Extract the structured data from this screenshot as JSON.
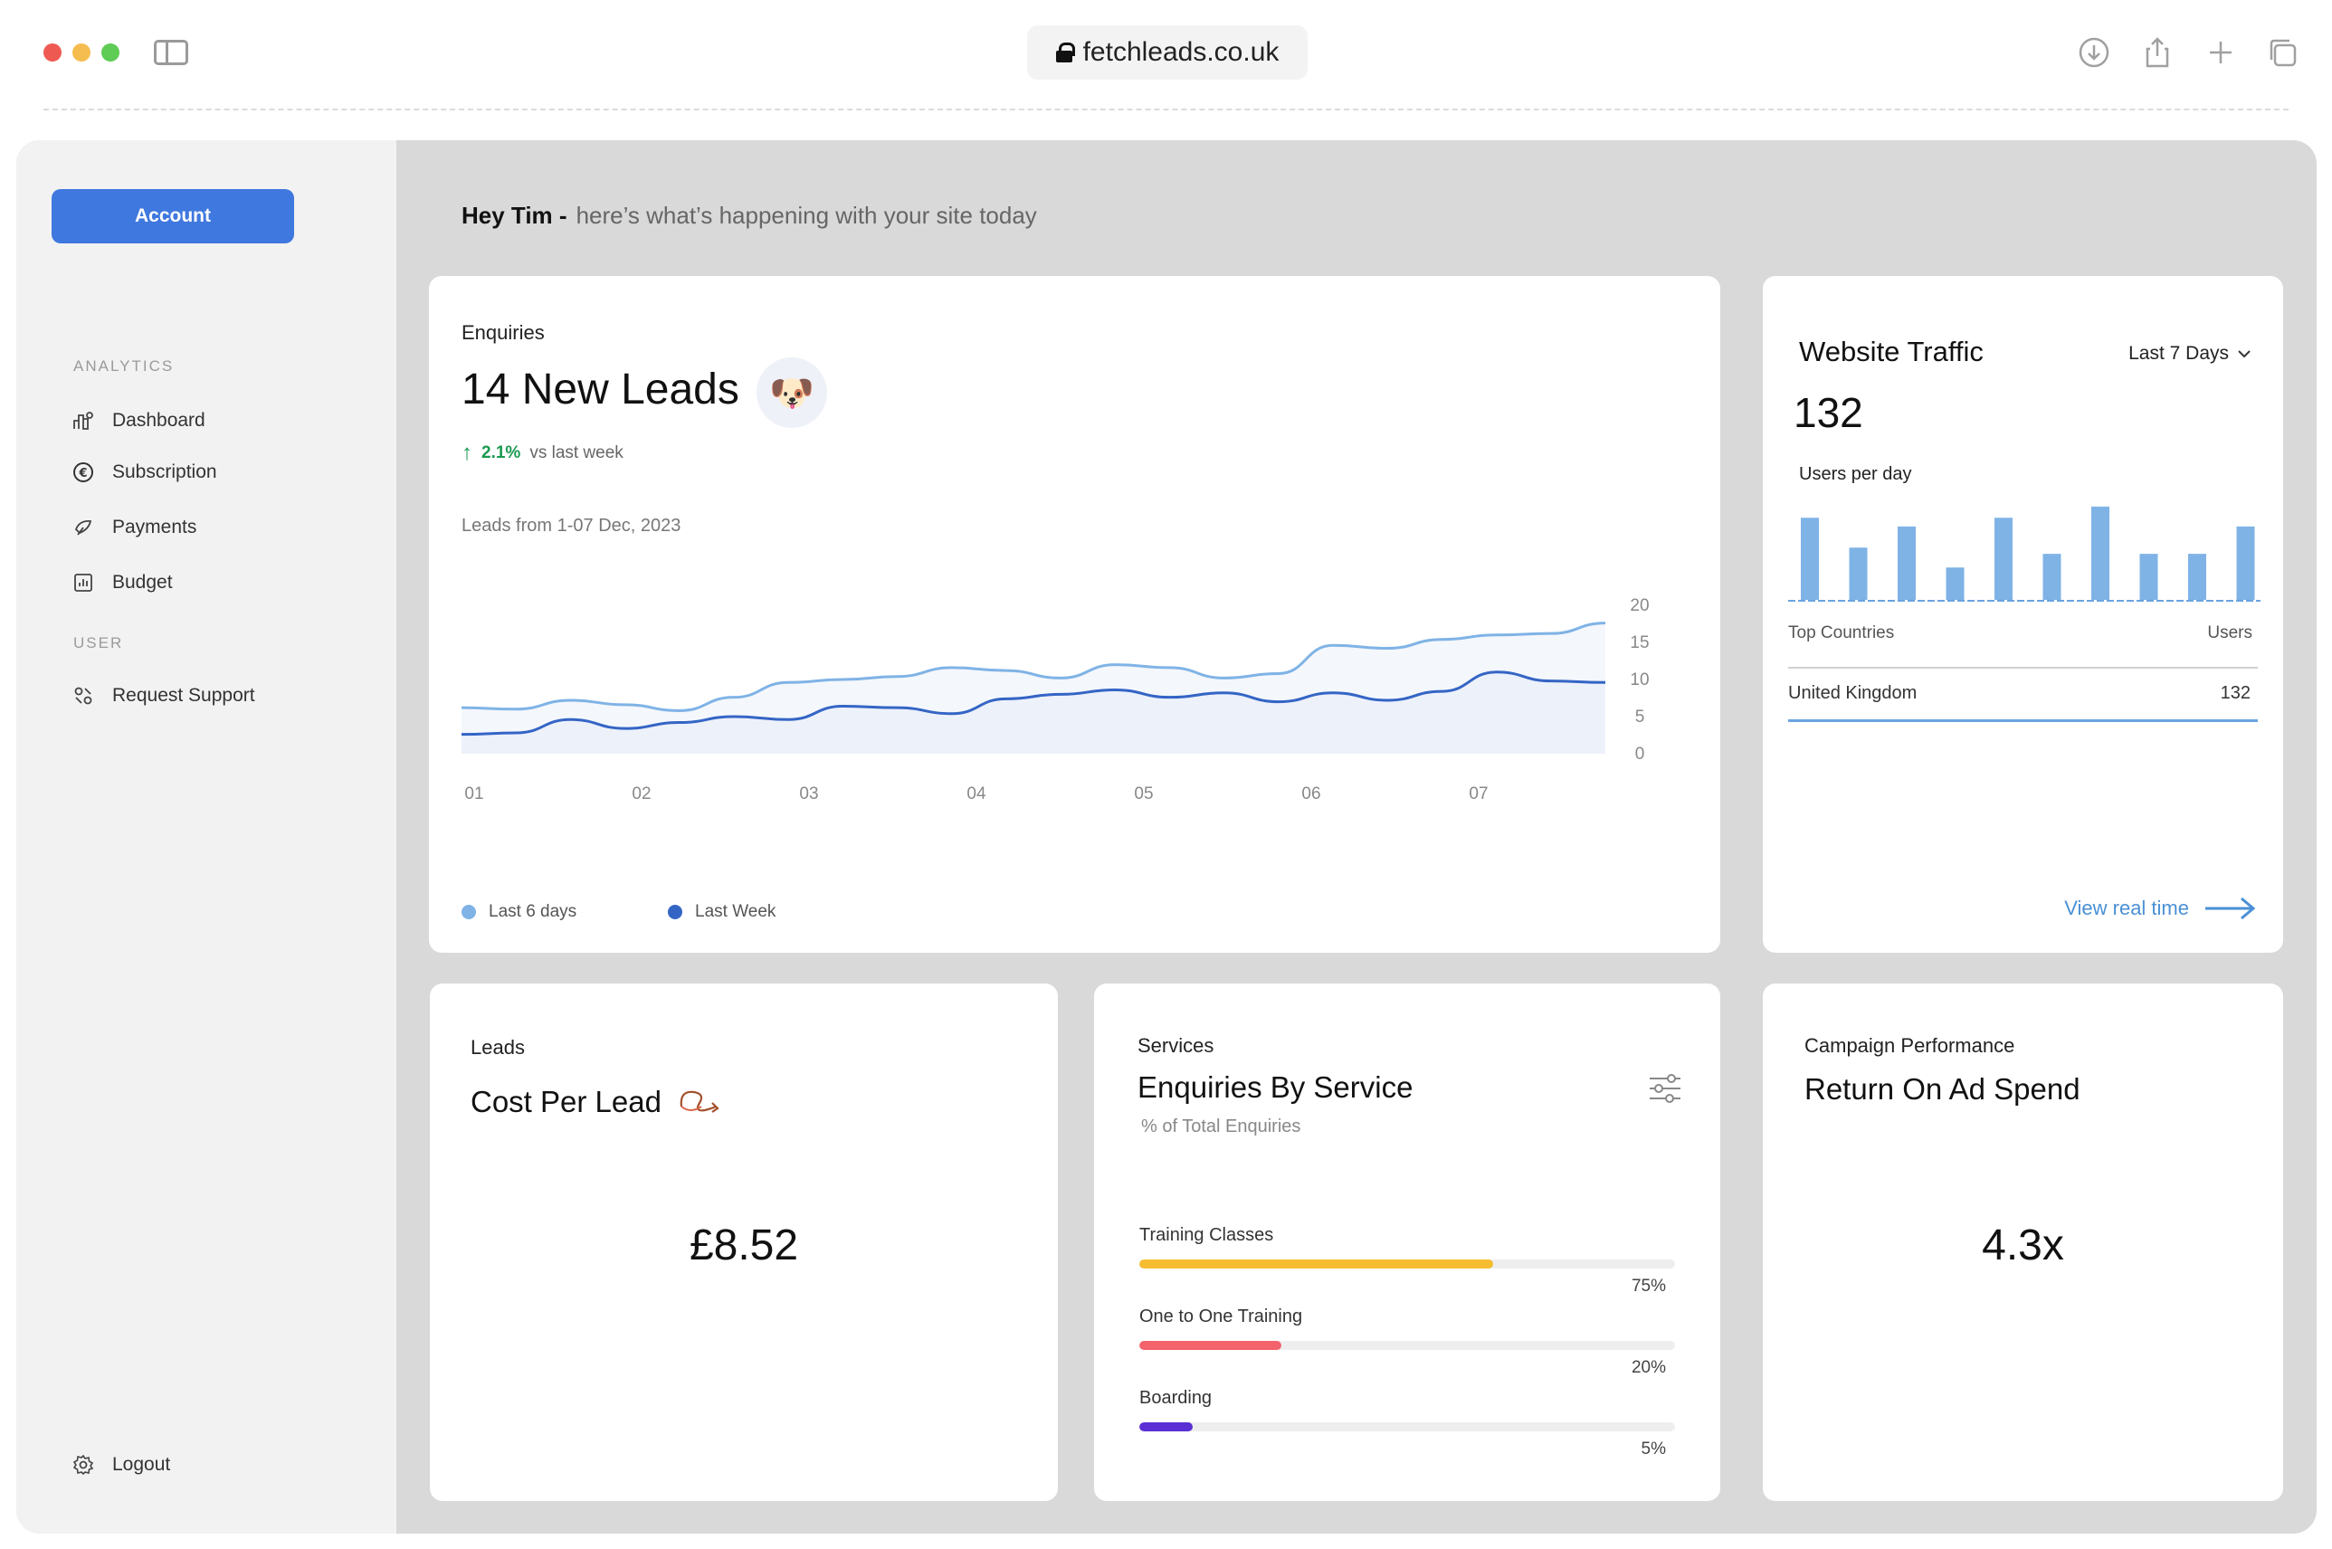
{
  "browser": {
    "url": "fetchleads.co.uk"
  },
  "sidebar": {
    "account_button": "Account",
    "section_analytics": "ANALYTICS",
    "section_user": "USER",
    "items": [
      {
        "label": "Dashboard",
        "icon": "bar-chart-icon"
      },
      {
        "label": "Subscription",
        "icon": "euro-icon"
      },
      {
        "label": "Payments",
        "icon": "payments-icon"
      },
      {
        "label": "Budget",
        "icon": "budget-icon"
      },
      {
        "label": "Request Support",
        "icon": "support-icon"
      }
    ],
    "logout": "Logout"
  },
  "greeting": {
    "name": "Hey Tim -",
    "message": "here’s what’s happening with your site today"
  },
  "enquiries": {
    "label": "Enquiries",
    "headline": "14 New Leads",
    "delta_pct": "2.1%",
    "delta_text": "vs last week",
    "chart_subtitle": "Leads from 1-07 Dec, 2023",
    "legend": [
      "Last 6 days",
      "Last Week"
    ],
    "colors": {
      "series_a": "#7fb3e6",
      "series_b": "#3465c5",
      "area": "#edf1fa"
    }
  },
  "chart_data": {
    "type": "area",
    "x_ticks": [
      "01",
      "02",
      "03",
      "04",
      "05",
      "06",
      "07"
    ],
    "y_ticks": [
      "20",
      "15",
      "10",
      "5",
      "0"
    ],
    "ylim": [
      0,
      20
    ],
    "series": [
      {
        "name": "Last 6 days",
        "values": [
          6.2,
          6.0,
          7.2,
          6.6,
          5.8,
          7.6,
          9.6,
          10.0,
          10.4,
          11.6,
          11.2,
          10.2,
          12.0,
          11.6,
          10.2,
          10.8,
          14.6,
          14.2,
          15.4,
          16.0,
          16.2,
          17.6
        ]
      },
      {
        "name": "Last Week",
        "values": [
          2.6,
          2.8,
          4.6,
          3.4,
          4.2,
          5.0,
          4.6,
          6.4,
          6.2,
          5.4,
          7.4,
          8.0,
          8.6,
          7.6,
          8.2,
          7.0,
          8.2,
          7.2,
          8.4,
          11.0,
          9.8,
          9.6
        ]
      }
    ]
  },
  "traffic": {
    "title": "Website Traffic",
    "range": "Last 7 Days",
    "value": "132",
    "subtitle": "Users per day",
    "bars": [
      66,
      42,
      59,
      26,
      66,
      37,
      75,
      37,
      37,
      59
    ],
    "col_country": "Top Countries",
    "col_users": "Users",
    "rows": [
      {
        "country": "United Kingdom",
        "users": "132"
      }
    ],
    "link": "View real time",
    "bar_color": "#7fb3e6"
  },
  "cpl": {
    "label": "Leads",
    "title": "Cost Per Lead",
    "value": "£8.52"
  },
  "services": {
    "label": "Services",
    "title": "Enquiries By Service",
    "subtitle": "% of Total Enquiries",
    "rows": [
      {
        "label": "Training Classes",
        "pct": "75%",
        "value": 0.66,
        "color": "#f5bd2f"
      },
      {
        "label": "One to One Training",
        "pct": "20%",
        "value": 0.265,
        "color": "#f2636b"
      },
      {
        "label": "Boarding",
        "pct": "5%",
        "value": 0.1,
        "color": "#5a2fd4"
      }
    ]
  },
  "roas": {
    "label": "Campaign Performance",
    "title": "Return On Ad Spend",
    "value": "4.3x"
  }
}
